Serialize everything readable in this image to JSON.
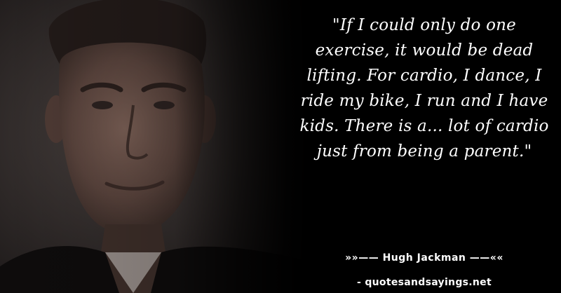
{
  "quote": {
    "text": "\"If I could only do one exercise, it would be dead lifting. For cardio, I dance, I ride my bike, I run and I have kids. There is a... lot of cardio just from being a parent.\""
  },
  "attribution": {
    "author_line": "»»—— Hugh Jackman ——««",
    "site_line": "- quotesandsayings.net"
  },
  "colors": {
    "background": "#000000",
    "text": "#ffffff"
  }
}
